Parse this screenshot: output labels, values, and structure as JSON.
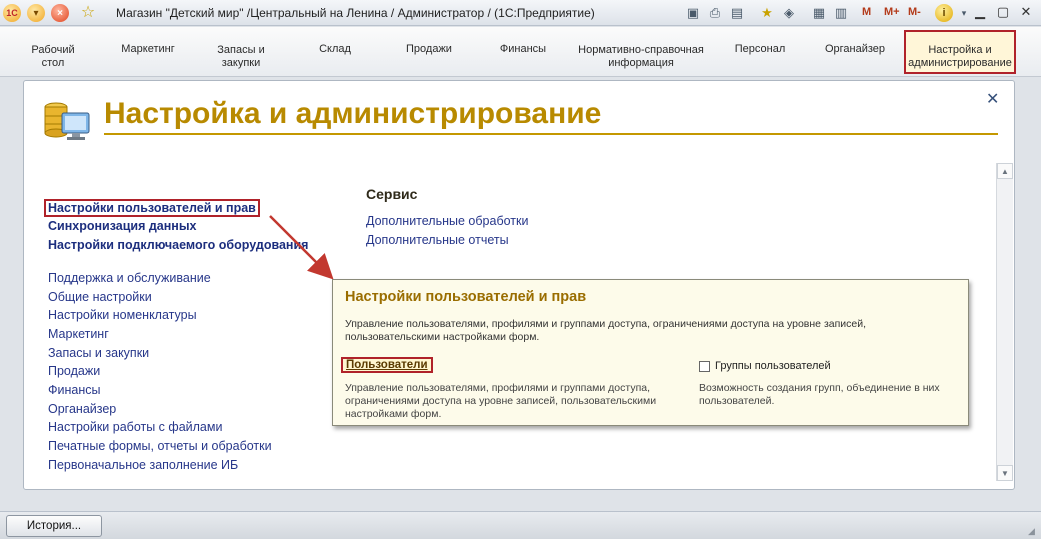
{
  "window": {
    "title": "Магазин \"Детский мир\" /Центральный на Ленина / Администратор /  (1С:Предприятие)",
    "logo_text": "1C",
    "m_buttons": [
      "M",
      "M+",
      "M-"
    ],
    "info_icon_text": "i"
  },
  "sections": [
    {
      "label": "Рабочий стол"
    },
    {
      "label": "Маркетинг"
    },
    {
      "label": "Запасы и закупки"
    },
    {
      "label": "Склад"
    },
    {
      "label": "Продажи"
    },
    {
      "label": "Финансы"
    },
    {
      "label": "Нормативно-справочная информация"
    },
    {
      "label": "Персонал"
    },
    {
      "label": "Органайзер"
    },
    {
      "label": "Настройка и администрирование"
    }
  ],
  "page": {
    "title": "Настройка и администрирование"
  },
  "nav": {
    "bold_links": [
      "Настройки пользователей и прав",
      "Синхронизация данных",
      "Настройки подключаемого оборудования"
    ],
    "links": [
      "Поддержка и обслуживание",
      "Общие настройки",
      "Настройки номенклатуры",
      "Маркетинг",
      "Запасы и закупки",
      "Продажи",
      "Финансы",
      "Органайзер",
      "Настройки работы с файлами",
      "Печатные формы, отчеты и обработки",
      "Первоначальное заполнение ИБ"
    ]
  },
  "service": {
    "title": "Сервис",
    "links": [
      "Дополнительные обработки",
      "Дополнительные отчеты"
    ]
  },
  "popup": {
    "title": "Настройки пользователей и прав",
    "description": "Управление пользователями, профилями и группами доступа, ограничениями доступа на уровне записей, пользовательскими настройками форм.",
    "users_link": "Пользователи",
    "users_description": "Управление пользователями, профилями и группами доступа, ограничениями доступа на уровне записей, пользовательскими настройками форм.",
    "groups_label": "Группы пользователей",
    "groups_checked": false,
    "groups_description": "Возможность создания групп, объединение в них пользователей."
  },
  "statusbar": {
    "history_label": "История..."
  },
  "colors": {
    "accent_title": "#b88a00",
    "highlight_border": "#b0222a",
    "link": "#27378a",
    "popup_bg": "#fdfbea"
  }
}
